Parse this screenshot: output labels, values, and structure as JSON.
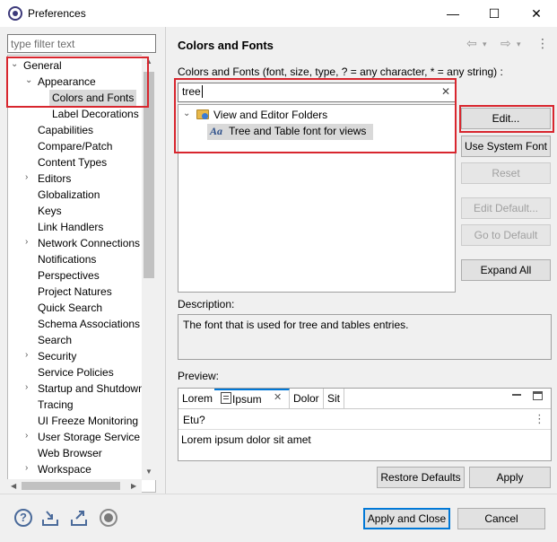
{
  "window": {
    "title": "Preferences",
    "minimize_glyph": "—",
    "maximize_glyph": "☐",
    "close_glyph": "✕"
  },
  "filter": {
    "placeholder": "type filter text"
  },
  "tree": {
    "items": [
      {
        "label": "General",
        "expanded": true
      },
      {
        "label": "Appearance",
        "expanded": true
      },
      {
        "label": "Colors and Fonts",
        "selected": true
      },
      {
        "label": "Label Decorations"
      },
      {
        "label": "Capabilities"
      },
      {
        "label": "Compare/Patch"
      },
      {
        "label": "Content Types"
      },
      {
        "label": "Editors",
        "expandable": true
      },
      {
        "label": "Globalization"
      },
      {
        "label": "Keys"
      },
      {
        "label": "Link Handlers"
      },
      {
        "label": "Network Connections",
        "expandable": true
      },
      {
        "label": "Notifications"
      },
      {
        "label": "Perspectives"
      },
      {
        "label": "Project Natures"
      },
      {
        "label": "Quick Search"
      },
      {
        "label": "Schema Associations"
      },
      {
        "label": "Search"
      },
      {
        "label": "Security",
        "expandable": true
      },
      {
        "label": "Service Policies"
      },
      {
        "label": "Startup and Shutdown",
        "expandable": true
      },
      {
        "label": "Tracing"
      },
      {
        "label": "UI Freeze Monitoring"
      },
      {
        "label": "User Storage Service",
        "expandable": true
      },
      {
        "label": "Web Browser"
      },
      {
        "label": "Workspace",
        "expandable": true
      }
    ]
  },
  "page": {
    "title": "Colors and Fonts",
    "description_line": "Colors and Fonts (font, size, type, ? = any character, * = any string) :",
    "search_value": "tree",
    "font_tree": {
      "folder": "View and Editor Folders",
      "font_item": "Tree and Table font for views",
      "font_icon_glyph": "Aa"
    },
    "buttons": {
      "edit": "Edit...",
      "use_system_font": "Use System Font",
      "reset": "Reset",
      "edit_default": "Edit Default...",
      "go_to_default": "Go to Default",
      "expand_all": "Expand All"
    },
    "description_label": "Description:",
    "description_text": "The font that is used for tree and tables entries.",
    "preview_label": "Preview:",
    "preview": {
      "tabs": [
        "Lorem",
        "Ipsum",
        "Dolor",
        "Sit"
      ],
      "toolbar_text": "Etu?",
      "body_text": "Lorem ipsum dolor sit amet"
    },
    "restore_defaults": "Restore Defaults",
    "apply": "Apply"
  },
  "footer": {
    "apply_and_close": "Apply and Close",
    "cancel": "Cancel"
  },
  "colors": {
    "highlight": "#d8262e",
    "selection": "#d9d9d9",
    "accent_border": "#0078d7"
  }
}
